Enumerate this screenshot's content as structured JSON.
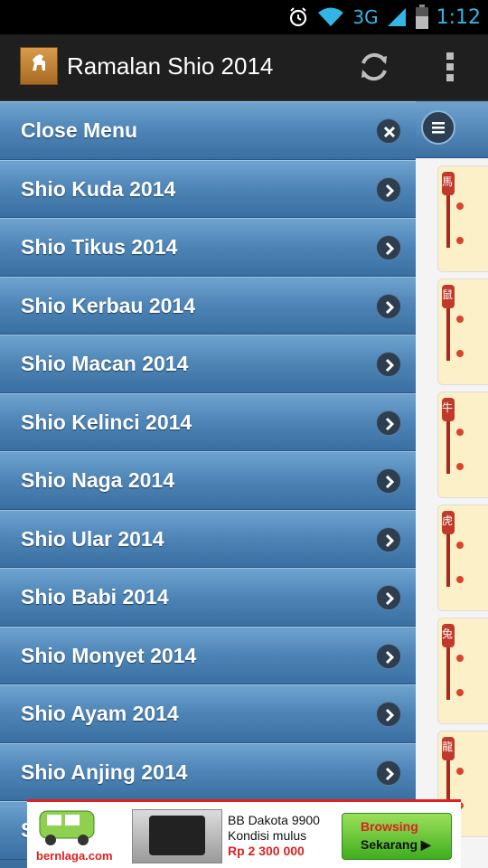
{
  "status_bar": {
    "network": "3G",
    "time": "1:12",
    "icons": [
      "alarm-icon",
      "wifi-icon",
      "signal-icon",
      "battery-icon"
    ]
  },
  "action_bar": {
    "title": "Ramalan Shio 2014",
    "logo_text": "Ramalan Shio 2014",
    "icons": [
      "app-logo",
      "refresh-icon",
      "overflow-menu-icon"
    ]
  },
  "menu": {
    "items": [
      {
        "label": "Close Menu",
        "icon": "close-icon"
      },
      {
        "label": "Shio Kuda 2014",
        "icon": "chevron-right-icon"
      },
      {
        "label": "Shio Tikus 2014",
        "icon": "chevron-right-icon"
      },
      {
        "label": "Shio Kerbau 2014",
        "icon": "chevron-right-icon"
      },
      {
        "label": "Shio Macan 2014",
        "icon": "chevron-right-icon"
      },
      {
        "label": "Shio Kelinci 2014",
        "icon": "chevron-right-icon"
      },
      {
        "label": "Shio Naga 2014",
        "icon": "chevron-right-icon"
      },
      {
        "label": "Shio Ular 2014",
        "icon": "chevron-right-icon"
      },
      {
        "label": "Shio Babi 2014",
        "icon": "chevron-right-icon"
      },
      {
        "label": "Shio Monyet 2014",
        "icon": "chevron-right-icon"
      },
      {
        "label": "Shio Ayam 2014",
        "icon": "chevron-right-icon"
      },
      {
        "label": "Shio Anjing 2014",
        "icon": "chevron-right-icon"
      },
      {
        "label": "S",
        "icon": ""
      }
    ]
  },
  "content": {
    "glyphs": [
      "馬",
      "鼠",
      "牛",
      "虎",
      "兔",
      "龍"
    ]
  },
  "ad": {
    "brand": "bernlaga.com",
    "product": "BB Dakota 9900",
    "condition": "Kondisi mulus",
    "price": "Rp 2 300 000",
    "cta_line1": "Browsing",
    "cta_line2": "Sekarang ▶"
  },
  "colors": {
    "menu_top": "#6fa3cf",
    "menu_bottom": "#3a6fa1",
    "status_accent": "#33b5e5",
    "action_bar": "#1f1f1f",
    "ad_red": "#e02020"
  }
}
